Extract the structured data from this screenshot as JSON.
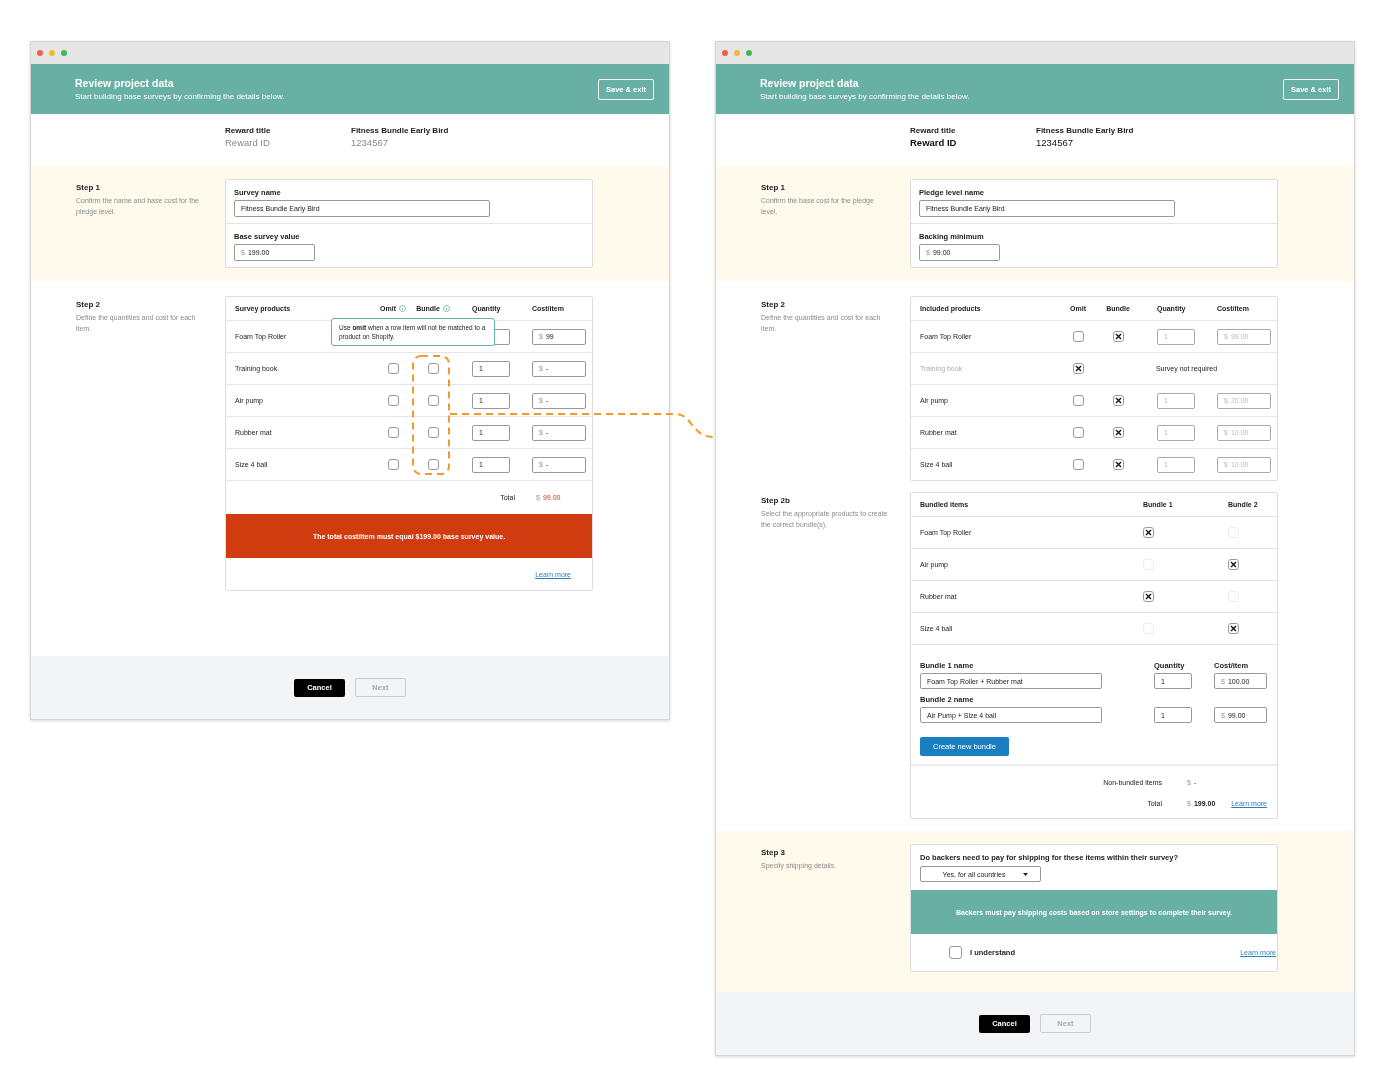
{
  "windows": [
    {
      "header": {
        "title": "Review project data",
        "subtitle": "Start building base surveys by confirming the details below.",
        "button": "Save & exit"
      },
      "reward": {
        "title_label": "Reward title",
        "title_value": "Fitness Bundle Early Bird",
        "id_label": "Reward ID",
        "id_value": "1234567",
        "id_emphasized": false
      },
      "sections": [
        {
          "kind": "fields",
          "shaded": true,
          "step": "Step 1",
          "description": "Confirm the name and base cost for the pledge level.",
          "fields": [
            {
              "label": "Survey name",
              "value": "Fitness Bundle Early Bird"
            },
            {
              "label": "Base survey value",
              "currency": "$",
              "value": "199.00"
            }
          ]
        },
        {
          "kind": "products",
          "shaded": false,
          "step": "Step 2",
          "description": "Define the quantities and cost for each item.",
          "columns": [
            {
              "label": "Survey products"
            },
            {
              "label": "Omit",
              "info": true
            },
            {
              "label": "Bundle",
              "info": true
            },
            {
              "label": "Quantity"
            },
            {
              "label": "Cost/item"
            }
          ],
          "rows": [
            {
              "name": "Foam Top Roller",
              "currency": "$",
              "cost": "99"
            },
            {
              "name": "Training book",
              "omit": false,
              "bundle": false,
              "quantity": "1",
              "currency": "$",
              "cost": "-",
              "disabled": false
            },
            {
              "name": "Air pump",
              "omit": false,
              "bundle": false,
              "quantity": "1",
              "currency": "$",
              "cost": "-",
              "disabled": false
            },
            {
              "name": "Rubber mat",
              "omit": false,
              "bundle": false,
              "quantity": "1",
              "currency": "$",
              "cost": "-",
              "disabled": false
            },
            {
              "name": "Size 4 ball",
              "omit": false,
              "bundle": false,
              "quantity": "1",
              "currency": "$",
              "cost": "-",
              "disabled": false
            }
          ],
          "total": {
            "label": "Total",
            "currency": "$",
            "value": "99.00",
            "error": true
          },
          "error": "The total cost/item must equal $199.00 base survey value.",
          "link": "Learn more",
          "tooltip": "Use **omit** when a row item will not be matched to a product on Shopify."
        }
      ],
      "footer": {
        "cancel": "Cancel",
        "next": "Next",
        "next_disabled": true
      }
    },
    {
      "header": {
        "title": "Review project data",
        "subtitle": "Start building base surveys by confirming the details below.",
        "button": "Save & exit"
      },
      "reward": {
        "title_label": "Reward title",
        "title_value": "Fitness Bundle Early Bird",
        "id_label": "Reward ID",
        "id_value": "1234567",
        "id_emphasized": true
      },
      "sections": [
        {
          "kind": "fields",
          "shaded": true,
          "step": "Step 1",
          "description": "Confirm the base cost for the pledge level.",
          "fields": [
            {
              "label": "Pledge level name",
              "value": "Fitness Bundle Early Bird"
            },
            {
              "label": "Backing minimum",
              "currency": "$",
              "value": "99.00"
            }
          ]
        },
        {
          "kind": "products",
          "shaded": false,
          "step": "Step 2",
          "description": "Define the quantities and cost for each item.",
          "columns": [
            {
              "label": "Included products"
            },
            {
              "label": "Omit"
            },
            {
              "label": "Bundle"
            },
            {
              "label": "Quantity"
            },
            {
              "label": "Cost/item"
            }
          ],
          "rows": [
            {
              "name": "Foam Top Roller",
              "omit": false,
              "bundle": true,
              "quantity": "1",
              "currency": "$",
              "cost": "99.00",
              "disabled": true
            },
            {
              "name": "Training book",
              "omit": true,
              "note": "Survey not required"
            },
            {
              "name": "Air pump",
              "omit": false,
              "bundle": true,
              "quantity": "1",
              "currency": "$",
              "cost": "20.00",
              "disabled": true
            },
            {
              "name": "Rubber mat",
              "omit": false,
              "bundle": true,
              "quantity": "1",
              "currency": "$",
              "cost": "10.00",
              "disabled": true
            },
            {
              "name": "Size 4 ball",
              "omit": false,
              "bundle": true,
              "quantity": "1",
              "currency": "$",
              "cost": "10.00",
              "disabled": true
            }
          ]
        },
        {
          "kind": "bundles",
          "shaded": false,
          "step": "Step 2b",
          "description": "Select the appropriate products to create the correct bundle(s).",
          "columns": [
            {
              "label": "Bundled items"
            },
            {
              "label": "Bundle 1"
            },
            {
              "label": "Bundle 2"
            }
          ],
          "rows": [
            {
              "name": "Foam Top Roller",
              "cells": [
                {
                  "checked": true,
                  "disabled": false
                },
                {
                  "checked": false,
                  "disabled": true
                }
              ]
            },
            {
              "name": "Air pump",
              "cells": [
                {
                  "checked": false,
                  "disabled": true
                },
                {
                  "checked": true,
                  "disabled": false
                }
              ]
            },
            {
              "name": "Rubber mat",
              "cells": [
                {
                  "checked": true,
                  "disabled": false
                },
                {
                  "checked": false,
                  "disabled": true
                }
              ]
            },
            {
              "name": "Size 4 ball",
              "cells": [
                {
                  "checked": false,
                  "disabled": true
                },
                {
                  "checked": true,
                  "disabled": false
                }
              ]
            }
          ],
          "quantity_label": "Quantity",
          "cost_label": "Cost/item",
          "bundles": [
            {
              "label": "Bundle 1 name",
              "name": "Foam Top Roller + Rubber mat",
              "quantity": "1",
              "currency": "$",
              "cost": "100.00"
            },
            {
              "label": "Bundle 2 name",
              "name": "Air Pump + Size 4 ball",
              "quantity": "1",
              "currency": "$",
              "cost": "99.00"
            }
          ],
          "button": "Create new bundle",
          "summary": [
            {
              "label": "Non-bundled items",
              "currency": "$",
              "value": "-"
            },
            {
              "label": "Total",
              "currency": "$",
              "value": "199.00",
              "bold": true
            }
          ],
          "link": "Learn more"
        },
        {
          "kind": "shipping",
          "shaded": true,
          "step": "Step 3",
          "description": "Specify shipping details.",
          "question": "Do backers need to pay for shipping for these items within their survey?",
          "dropdown": "Yes, for all countries",
          "banner": "Backers must pay shipping costs based on store settings to complete their survey.",
          "checkbox": {
            "label": "I understand",
            "checked": false
          },
          "link": "Learn more"
        }
      ],
      "footer": {
        "cancel": "Cancel",
        "next": "Next",
        "next_disabled": true
      }
    }
  ]
}
